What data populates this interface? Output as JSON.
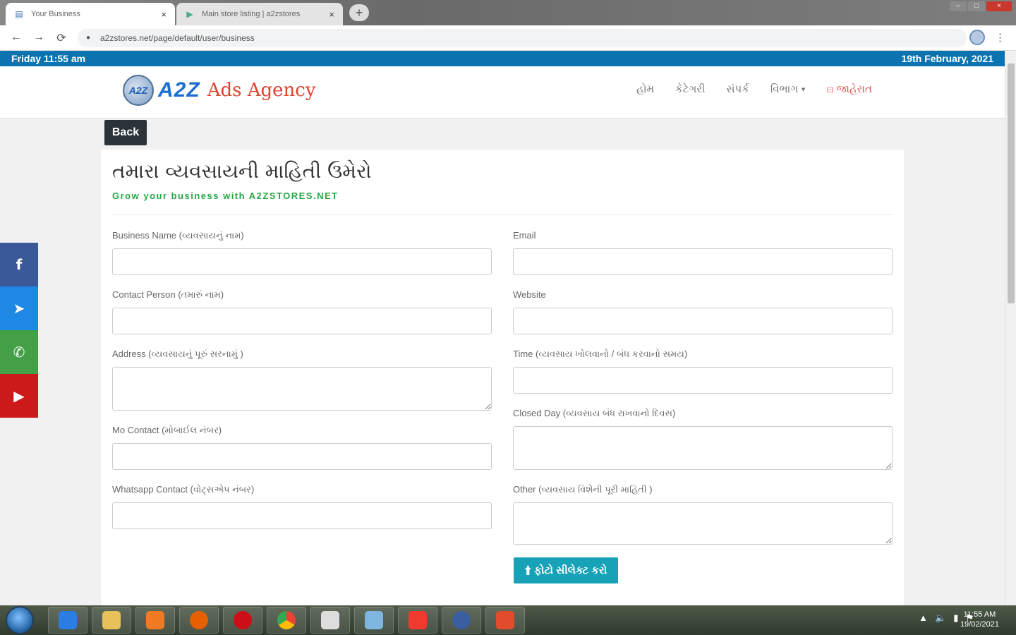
{
  "browser": {
    "tabs": [
      {
        "title": "Your Business",
        "close": "×"
      },
      {
        "title": "Main store listing | a2zstores",
        "close": "×"
      }
    ],
    "new_tab": "+",
    "window_controls": {
      "minimize": "–",
      "maximize": "□",
      "close": "×"
    },
    "url": "a2zstores.net/page/default/user/business",
    "nav": {
      "back": "←",
      "forward": "→",
      "reload": "⟳"
    },
    "star": "☆",
    "menu": "⋮"
  },
  "topbar": {
    "day_time": "Friday 11:55 am",
    "date": "19th February, 2021"
  },
  "site": {
    "logo_badge": "A2Z",
    "logo_main": "A2Z",
    "logo_sub": "Ads Agency",
    "nav": [
      {
        "label": "હોમ"
      },
      {
        "label": "કેટેગરી"
      },
      {
        "label": "સંપર્ક"
      },
      {
        "label": "વિભાગ ▾"
      },
      {
        "label": "⊡ જાહેરાત"
      }
    ]
  },
  "back_button": "Back",
  "form": {
    "title": "તમારા વ્યવસાયની માહિતી ઉમેરો",
    "subtitle": "Grow your business with A2ZSTORES.NET",
    "left_fields": [
      {
        "label": "Business Name (વ્યવસાયનું નામ)",
        "value": ""
      },
      {
        "label": "Contact Person (તમારું નામ)",
        "value": ""
      },
      {
        "label": "Address (વ્યવસાયનું પૂરું સરનામું )",
        "value": ""
      },
      {
        "label": "Mo Contact (મોબાઈલ નંબર)",
        "value": ""
      },
      {
        "label": "Whatsapp Contact (વોટ્સએપ નંબર)",
        "value": ""
      }
    ],
    "right_fields": [
      {
        "label": "Email",
        "value": ""
      },
      {
        "label": "Website",
        "value": ""
      },
      {
        "label": "Time (વ્યવસાય ખોલવાનો / બંધ કરવાનો સમય)",
        "value": ""
      },
      {
        "label": "Closed Day (વ્યવસાય બંધ રાખવાનો દિવસ)",
        "value": ""
      },
      {
        "label": "Other (વ્યવસાય વિશેની પૂરી માહિતી )",
        "value": ""
      }
    ],
    "submit": "⬆ ફોટો સીલેક્ટ કરો"
  },
  "social": [
    {
      "icon": "facebook-icon",
      "glyph": "f",
      "color": "#3b5998"
    },
    {
      "icon": "telegram-icon",
      "glyph": "➤",
      "color": "#1e88e5"
    },
    {
      "icon": "whatsapp-icon",
      "glyph": "✆",
      "color": "#43a047"
    },
    {
      "icon": "youtube-icon",
      "glyph": "▶",
      "color": "#cc1a1a"
    }
  ],
  "taskbar": {
    "apps": [
      {
        "name": "internet-explorer-icon",
        "color": "#2b7de1"
      },
      {
        "name": "file-explorer-icon",
        "color": "#e8c15a"
      },
      {
        "name": "media-player-icon",
        "color": "#f07a22"
      },
      {
        "name": "firefox-icon",
        "color": "#e66000"
      },
      {
        "name": "opera-icon",
        "color": "#cc0f16"
      },
      {
        "name": "chrome-icon",
        "color": "#34a853"
      },
      {
        "name": "app-icon-printer",
        "color": "#dddddd"
      },
      {
        "name": "app-icon-notes",
        "color": "#7fb6e0"
      },
      {
        "name": "app-icon-anydesk",
        "color": "#ef3b2d"
      },
      {
        "name": "app-icon-media",
        "color": "#3a5f9e"
      },
      {
        "name": "app-icon-pdf",
        "color": "#e24b2c"
      }
    ],
    "tray": [
      "▲",
      "🔈",
      "▮",
      "⚑"
    ],
    "time": "11:55 AM",
    "date": "19/02/2021"
  }
}
